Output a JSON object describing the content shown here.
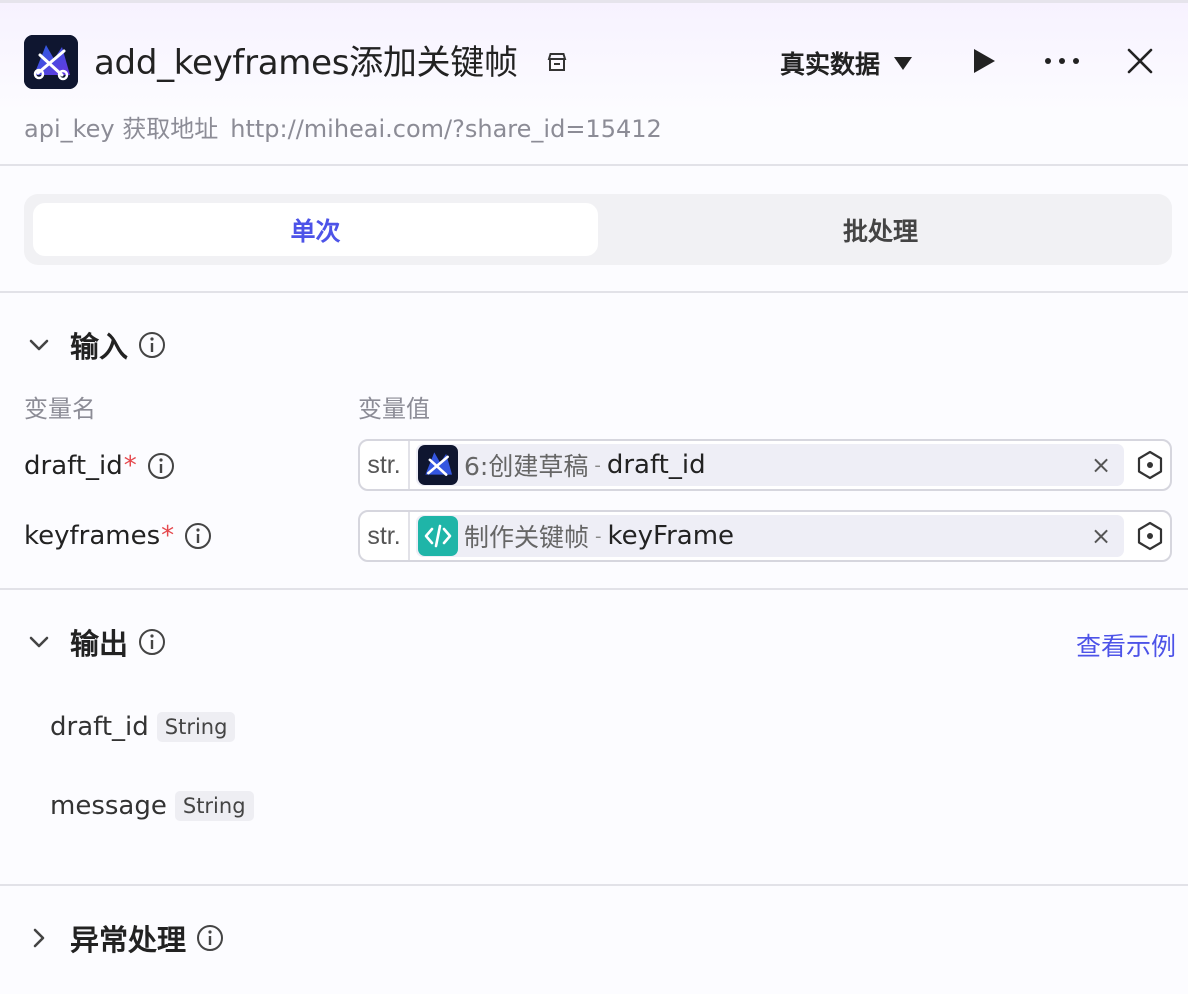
{
  "header": {
    "title": "add_keyframes添加关键帧",
    "data_mode": "真实数据",
    "subtitle_key": "api_key 获取地址",
    "subtitle_url": "http://miheai.com/?share_id=15412"
  },
  "tabs": [
    {
      "label": "单次",
      "active": true
    },
    {
      "label": "批处理",
      "active": false
    }
  ],
  "input_section": {
    "title": "输入",
    "col_name": "变量名",
    "col_value": "变量值",
    "rows": [
      {
        "name": "draft_id",
        "required_mark": "*",
        "type": "str.",
        "ref_node": "6:创建草稿",
        "ref_sep": "-",
        "ref_field": "draft_id",
        "icon": "capcut-icon"
      },
      {
        "name": "keyframes",
        "required_mark": "*",
        "type": "str.",
        "ref_node": "制作关键帧",
        "ref_sep": "-",
        "ref_field": "keyFrame",
        "icon": "code-icon"
      }
    ],
    "clear_glyph": "×"
  },
  "output_section": {
    "title": "输出",
    "example_link": "查看示例",
    "fields": [
      {
        "name": "draft_id",
        "type": "String"
      },
      {
        "name": "message",
        "type": "String"
      }
    ]
  },
  "exception_section": {
    "title": "异常处理"
  },
  "colors": {
    "accent": "#4d53e8",
    "required": "#e5484d",
    "code_icon_bg": "#1fb5a8",
    "logo_bg": "#0f1630"
  }
}
